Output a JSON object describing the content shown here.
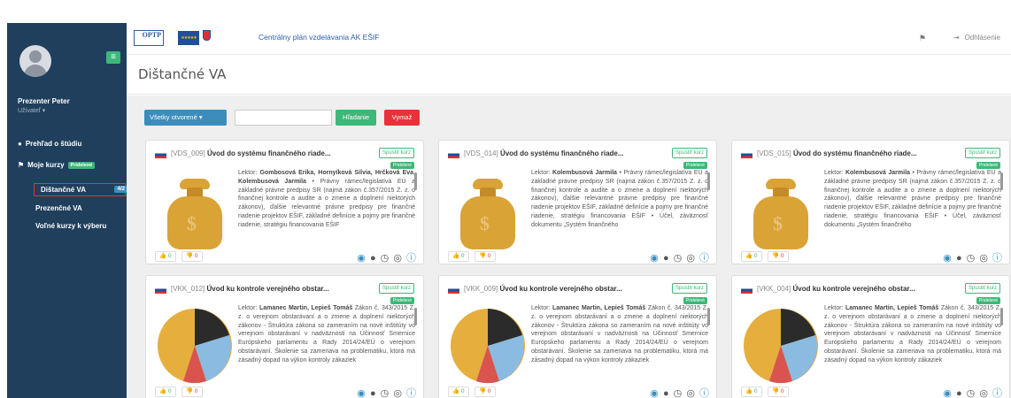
{
  "sidebar": {
    "user_name": "Prezenter Peter",
    "user_role": "Užívateľ",
    "nav": {
      "overview": "Prehľad o štúdiu",
      "my_courses": "Moje kurzy",
      "my_courses_badge": "Pridelené",
      "distance": "Dištančné VA",
      "distance_count": "4/2",
      "inperson": "Prezenčné VA",
      "free": "Voľné kurzy k výberu"
    }
  },
  "topbar": {
    "app_title": "Centrálny plán vzdelávania AK EŠIF",
    "logo_optp": "OPTP",
    "logout": "Odhlásenie"
  },
  "page": {
    "title": "Dištančné VA"
  },
  "toolbar": {
    "filter_label": "Všetky otvorené",
    "search_value": "",
    "search_label": "Hľadanie",
    "clear_label": "Vymaž"
  },
  "card_labels": {
    "launch": "Spustiť kurz",
    "assigned": "Pridelené"
  },
  "cards": [
    {
      "code": "[VDS_009]",
      "name": "Úvod do systému finančného riade...",
      "lecturer_label": "Lektor:",
      "lecturers": "Gombosová Erika, Hornyíková Silvia, Hrčková Eva, Kolembusová Jarmila",
      "desc": "• Právny rámec/legislatíva EÚ a základné právne predpisy SR (najmä zákon č.357/2015 Z. z. o finančnej kontrole a audite a o zmene a doplnení niektorých zákonov), ďalšie relevantné právne predpisy pre finančné riadenie projektov EŠIF, základné definície a pojmy pre finančné riadenie, stratégiu financovania EŠIF",
      "likes": "0",
      "dislikes": "0"
    },
    {
      "code": "[VDS_014]",
      "name": "Úvod do systému finančného riade...",
      "lecturer_label": "Lektor:",
      "lecturers": "Kolembusová Jarmila",
      "desc": "• Právny rámec/legislatíva EÚ a základné právne predpisy SR (najmä zákon č.357/2015 Z. z. o finančnej kontrole a audite a o zmene a doplnení niektorých zákonov), ďalšie relevantné právne predpisy pre finančné riadenie projektov EŠIF, základné definície a pojmy pre finančné riadenie, stratégiu financovania EŠIF • Účel, záväznosť dokumentu „Systém finančného",
      "likes": "0",
      "dislikes": "0"
    },
    {
      "code": "[VDS_015]",
      "name": "Úvod do systému finančného riade...",
      "lecturer_label": "Lektor:",
      "lecturers": "Kolembusová Jarmila",
      "desc": "• Právny rámec/legislatíva EÚ a základné právne predpisy SR (najmä zákon č.357/2015 Z. z. o finančnej kontrole a audite a o zmene a doplnení niektorých zákonov), ďalšie relevantné právne predpisy pre finančné riadenie projektov EŠIF, základné definície a pojmy pre finančné riadenie, stratégiu financovania EŠIF • Účel, záväznosť dokumentu „Systém finančného",
      "likes": "0",
      "dislikes": "0"
    },
    {
      "code": "[VKK_012]",
      "name": "Úvod ku kontrole verejného obstar...",
      "lecturer_label": "Lektor:",
      "lecturers": "Lamanec Martin, Lepieš Tomáš",
      "desc": "Zákon č. 343/2015 Z. z. o verejnom obstarávaní a o zmene a doplnení niektorých zákonov - Štruktúra zákona so zameraním na nové inštitúty vo verejnom obstarávaní v nadväznosti na Účinnosť Smernice Európskeho parlamentu a Rady 2014/24/EÚ o verejnom obstarávaní. Školenie sa zameriava na problematiku, ktorá má zásadný dopad na výkon kontroly zákaziek",
      "likes": "0",
      "dislikes": "0"
    },
    {
      "code": "[VKK_009]",
      "name": "Úvod ku kontrole verejného obstar...",
      "lecturer_label": "Lektor:",
      "lecturers": "Lamanec Martin, Lepieš Tomáš",
      "desc": "Zákon č. 343/2015 Z. z. o verejnom obstarávaní a o zmene a doplnení niektorých zákonov - Štruktúra zákona so zameraním na nové inštitúty vo verejnom obstarávaní v nadväznosti na Účinnosť Smernice Európskeho parlamentu a Rady 2014/24/EÚ o verejnom obstarávaní. Školenie sa zameriava na problematiku, ktorá má zásadný dopad na výkon kontroly zákaziek",
      "likes": "0",
      "dislikes": "0"
    },
    {
      "code": "[VKK_004]",
      "name": "Úvod ku kontrole verejného obstar...",
      "lecturer_label": "Lektor:",
      "lecturers": "Lamanec Martin, Lepieš Tomáš",
      "desc": "Zákon č. 343/2015 Z. z. o verejnom obstarávaní a o zmene a doplnení niektorých zákonov - Štruktúra zákona so zameraním na nové inštitúty vo verejnom obstarávaní v nadväznosti na Účinnosť Smernice Európskeho parlamentu a Rady 2014/24/EÚ o verejnom obstarávaní. Školenie sa zameriava na problematiku, ktorá má zásadný dopad na výkon kontroly zákaziek",
      "likes": "0",
      "dislikes": "0"
    }
  ],
  "colors": {
    "sidebar_bg": "#1f3f5d",
    "accent_blue": "#3c8dbc",
    "accent_green": "#3cb878",
    "accent_red": "#e8323a"
  }
}
